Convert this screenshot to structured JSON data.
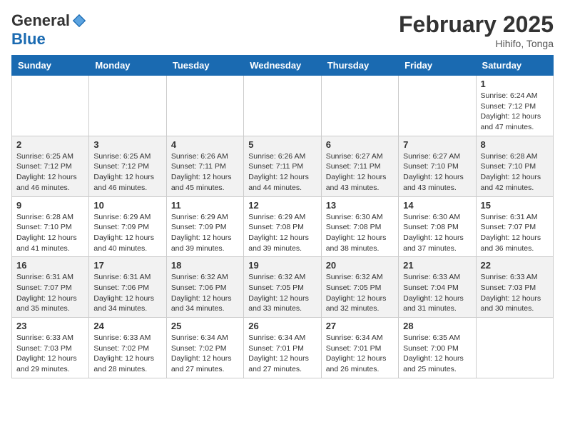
{
  "header": {
    "logo_general": "General",
    "logo_blue": "Blue",
    "month_title": "February 2025",
    "location": "Hihifo, Tonga"
  },
  "days_of_week": [
    "Sunday",
    "Monday",
    "Tuesday",
    "Wednesday",
    "Thursday",
    "Friday",
    "Saturday"
  ],
  "weeks": [
    [
      {
        "day": "",
        "info": ""
      },
      {
        "day": "",
        "info": ""
      },
      {
        "day": "",
        "info": ""
      },
      {
        "day": "",
        "info": ""
      },
      {
        "day": "",
        "info": ""
      },
      {
        "day": "",
        "info": ""
      },
      {
        "day": "1",
        "info": "Sunrise: 6:24 AM\nSunset: 7:12 PM\nDaylight: 12 hours\nand 47 minutes."
      }
    ],
    [
      {
        "day": "2",
        "info": "Sunrise: 6:25 AM\nSunset: 7:12 PM\nDaylight: 12 hours\nand 46 minutes."
      },
      {
        "day": "3",
        "info": "Sunrise: 6:25 AM\nSunset: 7:12 PM\nDaylight: 12 hours\nand 46 minutes."
      },
      {
        "day": "4",
        "info": "Sunrise: 6:26 AM\nSunset: 7:11 PM\nDaylight: 12 hours\nand 45 minutes."
      },
      {
        "day": "5",
        "info": "Sunrise: 6:26 AM\nSunset: 7:11 PM\nDaylight: 12 hours\nand 44 minutes."
      },
      {
        "day": "6",
        "info": "Sunrise: 6:27 AM\nSunset: 7:11 PM\nDaylight: 12 hours\nand 43 minutes."
      },
      {
        "day": "7",
        "info": "Sunrise: 6:27 AM\nSunset: 7:10 PM\nDaylight: 12 hours\nand 43 minutes."
      },
      {
        "day": "8",
        "info": "Sunrise: 6:28 AM\nSunset: 7:10 PM\nDaylight: 12 hours\nand 42 minutes."
      }
    ],
    [
      {
        "day": "9",
        "info": "Sunrise: 6:28 AM\nSunset: 7:10 PM\nDaylight: 12 hours\nand 41 minutes."
      },
      {
        "day": "10",
        "info": "Sunrise: 6:29 AM\nSunset: 7:09 PM\nDaylight: 12 hours\nand 40 minutes."
      },
      {
        "day": "11",
        "info": "Sunrise: 6:29 AM\nSunset: 7:09 PM\nDaylight: 12 hours\nand 39 minutes."
      },
      {
        "day": "12",
        "info": "Sunrise: 6:29 AM\nSunset: 7:08 PM\nDaylight: 12 hours\nand 39 minutes."
      },
      {
        "day": "13",
        "info": "Sunrise: 6:30 AM\nSunset: 7:08 PM\nDaylight: 12 hours\nand 38 minutes."
      },
      {
        "day": "14",
        "info": "Sunrise: 6:30 AM\nSunset: 7:08 PM\nDaylight: 12 hours\nand 37 minutes."
      },
      {
        "day": "15",
        "info": "Sunrise: 6:31 AM\nSunset: 7:07 PM\nDaylight: 12 hours\nand 36 minutes."
      }
    ],
    [
      {
        "day": "16",
        "info": "Sunrise: 6:31 AM\nSunset: 7:07 PM\nDaylight: 12 hours\nand 35 minutes."
      },
      {
        "day": "17",
        "info": "Sunrise: 6:31 AM\nSunset: 7:06 PM\nDaylight: 12 hours\nand 34 minutes."
      },
      {
        "day": "18",
        "info": "Sunrise: 6:32 AM\nSunset: 7:06 PM\nDaylight: 12 hours\nand 34 minutes."
      },
      {
        "day": "19",
        "info": "Sunrise: 6:32 AM\nSunset: 7:05 PM\nDaylight: 12 hours\nand 33 minutes."
      },
      {
        "day": "20",
        "info": "Sunrise: 6:32 AM\nSunset: 7:05 PM\nDaylight: 12 hours\nand 32 minutes."
      },
      {
        "day": "21",
        "info": "Sunrise: 6:33 AM\nSunset: 7:04 PM\nDaylight: 12 hours\nand 31 minutes."
      },
      {
        "day": "22",
        "info": "Sunrise: 6:33 AM\nSunset: 7:03 PM\nDaylight: 12 hours\nand 30 minutes."
      }
    ],
    [
      {
        "day": "23",
        "info": "Sunrise: 6:33 AM\nSunset: 7:03 PM\nDaylight: 12 hours\nand 29 minutes."
      },
      {
        "day": "24",
        "info": "Sunrise: 6:33 AM\nSunset: 7:02 PM\nDaylight: 12 hours\nand 28 minutes."
      },
      {
        "day": "25",
        "info": "Sunrise: 6:34 AM\nSunset: 7:02 PM\nDaylight: 12 hours\nand 27 minutes."
      },
      {
        "day": "26",
        "info": "Sunrise: 6:34 AM\nSunset: 7:01 PM\nDaylight: 12 hours\nand 27 minutes."
      },
      {
        "day": "27",
        "info": "Sunrise: 6:34 AM\nSunset: 7:01 PM\nDaylight: 12 hours\nand 26 minutes."
      },
      {
        "day": "28",
        "info": "Sunrise: 6:35 AM\nSunset: 7:00 PM\nDaylight: 12 hours\nand 25 minutes."
      },
      {
        "day": "",
        "info": ""
      }
    ]
  ]
}
